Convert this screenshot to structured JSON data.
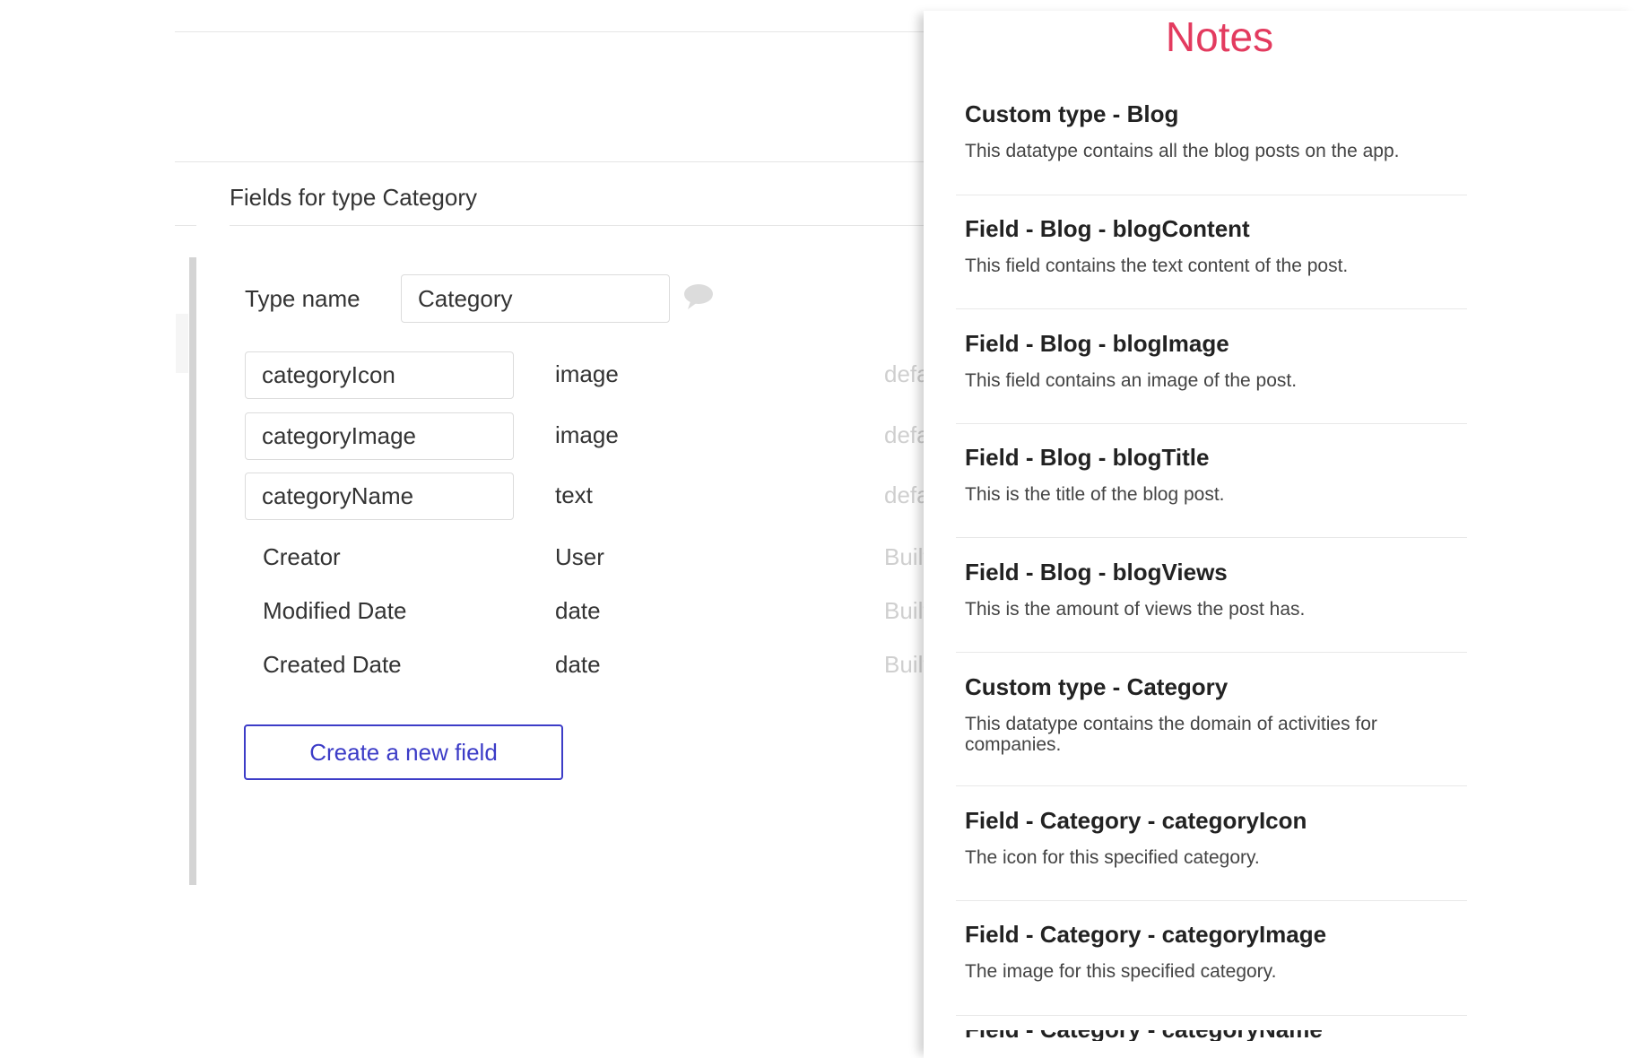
{
  "section_title": "Fields for type Category",
  "type_name": {
    "label": "Type name",
    "value": "Category"
  },
  "fields": [
    {
      "name": "categoryIcon",
      "type": "image",
      "extra": "defa"
    },
    {
      "name": "categoryImage",
      "type": "image",
      "extra": "defa"
    },
    {
      "name": "categoryName",
      "type": "text",
      "extra": "defa"
    }
  ],
  "builtin_fields": [
    {
      "name": "Creator",
      "type": "User",
      "extra": "Built"
    },
    {
      "name": "Modified Date",
      "type": "date",
      "extra": "Built"
    },
    {
      "name": "Created Date",
      "type": "date",
      "extra": "Built"
    }
  ],
  "create_button_label": "Create a new field",
  "notes": {
    "title": "Notes",
    "items": [
      {
        "title": "Custom type - Blog",
        "desc": "This datatype contains all the blog posts on the app."
      },
      {
        "title": "Field - Blog - blogContent",
        "desc": "This field contains the text content of the post."
      },
      {
        "title": "Field - Blog - blogImage",
        "desc": "This field contains an image of the post."
      },
      {
        "title": "Field - Blog - blogTitle",
        "desc": "This is the title of the blog post."
      },
      {
        "title": "Field - Blog - blogViews",
        "desc": "This is the amount of views the post has."
      },
      {
        "title": "Custom type - Category",
        "desc": "This datatype contains the domain of activities for companies."
      },
      {
        "title": "Field - Category - categoryIcon",
        "desc": "The icon for this specified category."
      },
      {
        "title": "Field - Category - categoryImage",
        "desc": "The image for this specified category."
      }
    ],
    "cutoff_title": "Field - Category - categoryName"
  },
  "colors": {
    "accent": "#3c3cc7",
    "notes_title": "#e33b5f"
  },
  "icons": {
    "comment": "chat-bubble-icon"
  }
}
